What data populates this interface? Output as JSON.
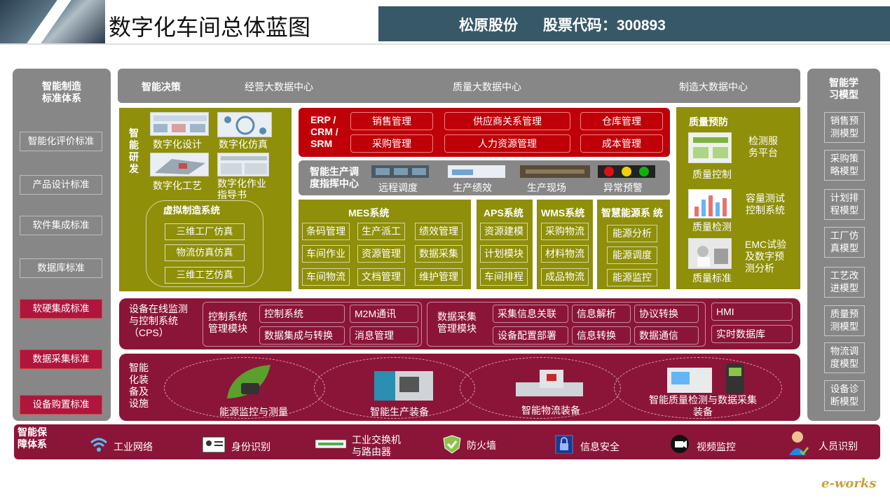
{
  "header": {
    "title": "数字化车间总体蓝图",
    "company": "松原股份",
    "stock": "股票代码：300893"
  },
  "left": {
    "title": "智能制造\n标准体系",
    "items": [
      "智能化评价标准",
      "产品设计标准",
      "软件集成标准",
      "数据库标准",
      "软硬集成标准",
      "数据采集标准",
      "设备购置标准"
    ]
  },
  "right": {
    "title": "智能学\n习模型",
    "items": [
      "销售预\n测模型",
      "采购策\n略模型",
      "计划排\n程模型",
      "工厂仿\n真模型",
      "工艺改\n进模型",
      "质量预\n测模型",
      "物流调\n度模型",
      "设备诊\n断模型"
    ]
  },
  "decision": {
    "label": "智能决策",
    "centers": [
      "经营大数据中心",
      "质量大数据中心",
      "制造大数据中心"
    ]
  },
  "research": {
    "label": "智能研发",
    "items": [
      "数字化设计",
      "数字化仿真",
      "数字化工艺",
      "数字化作业\n指导书"
    ],
    "virtual_title": "虚拟制造系统",
    "virtual_items": [
      "三维工厂仿真",
      "物流仿真仿真",
      "三维工艺仿真"
    ]
  },
  "erp": {
    "label": "ERP /\nCRM /\nSRM",
    "items": [
      "销售管理",
      "供应商关系管理",
      "仓库管理",
      "采购管理",
      "人力资源管理",
      "成本管理"
    ]
  },
  "command": {
    "label": "智能生产调\n度指挥中心",
    "items": [
      "远程调度",
      "生产绩效",
      "生产现场",
      "异常预警"
    ]
  },
  "mes": {
    "title": "MES系统",
    "items": [
      "条码管理",
      "生产派工",
      "绩效管理",
      "车间作业",
      "资源管理",
      "数据采集",
      "车间物流",
      "文档管理",
      "维护管理"
    ]
  },
  "aps": {
    "title": "APS系统",
    "items": [
      "资源建模",
      "计划模块",
      "车间排程"
    ]
  },
  "wms": {
    "title": "WMS系统",
    "items": [
      "采购物流",
      "材料物流",
      "成品物流"
    ]
  },
  "energy": {
    "title": "智慧能源系 统",
    "items": [
      "能源分析",
      "能源调度",
      "能源监控"
    ]
  },
  "quality": {
    "title": "质量预防",
    "items": [
      {
        "caption": "质量控制",
        "desc": "检测服\n务平台"
      },
      {
        "caption": "质量检测",
        "desc": "容量测试\n控制系统"
      },
      {
        "caption": "质量标准",
        "desc": "EMC试验\n及数字预\n测分析"
      }
    ]
  },
  "cps": {
    "label": "设备在线监测\n与控制系统\n（CPS）",
    "control_label": "控制系统\n管理模块",
    "control_items": [
      "控制系统",
      "M2M通讯",
      "数据集成与转换",
      "消息管理"
    ],
    "data_label": "数据采集\n管理模块",
    "data_items": [
      "采集信息关联",
      "信息解析",
      "协议转换",
      "设备配置部署",
      "信息转换",
      "数据通信"
    ],
    "extra_items": [
      "HMI",
      "实时数据库"
    ]
  },
  "equipment": {
    "label": "智能\n化装\n备及\n设施",
    "items": [
      "能源监控与测量",
      "智能生产装备",
      "智能物流装备",
      "智能质量检测与数据采集\n装备"
    ]
  },
  "guarantee": {
    "label": "智能保\n障体系",
    "items": [
      "工业网络",
      "身份识别",
      "工业交换机\n与路由器",
      "防火墙",
      "信息安全",
      "视频监控",
      "人员识别"
    ]
  },
  "brand": "e-works",
  "colors": {
    "gray": "#878787",
    "olive": "#8f8f0a",
    "red": "#c00008",
    "maroon": "#8b1538",
    "banner": "#375867"
  }
}
